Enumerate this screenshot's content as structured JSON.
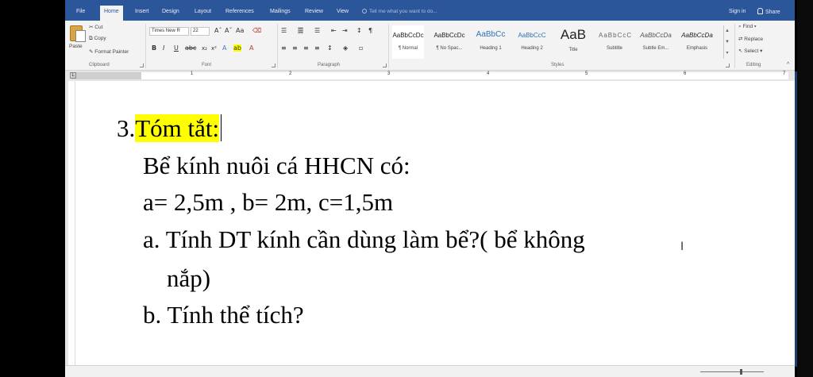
{
  "menu": {
    "tabs": [
      "File",
      "Home",
      "Insert",
      "Design",
      "Layout",
      "References",
      "Mailings",
      "Review",
      "View"
    ],
    "active_tab": "Home",
    "tell_me": "Tell me what you want to do...",
    "sign_in": "Sign in",
    "share": "Share"
  },
  "ribbon": {
    "clipboard": {
      "paste": "Paste",
      "cut": "Cut",
      "copy": "Copy",
      "format_painter": "Format Painter",
      "label": "Clipboard"
    },
    "font": {
      "family": "Times New R",
      "size": "22",
      "label": "Font"
    },
    "paragraph": {
      "label": "Paragraph"
    },
    "styles": {
      "label": "Styles",
      "items": [
        {
          "sample": "AaBbCcDc",
          "name": "¶ Normal"
        },
        {
          "sample": "AaBbCcDc",
          "name": "¶ No Spac..."
        },
        {
          "sample": "AaBbCc",
          "name": "Heading 1"
        },
        {
          "sample": "AaBbCcC",
          "name": "Heading 2"
        },
        {
          "sample": "AaB",
          "name": "Title"
        },
        {
          "sample": "AaBbCcC",
          "name": "Subtitle"
        },
        {
          "sample": "AaBbCcDa",
          "name": "Subtle Em..."
        },
        {
          "sample": "AaBbCcDa",
          "name": "Emphasis"
        }
      ]
    },
    "editing": {
      "find": "Find",
      "replace": "Replace",
      "select": "Select",
      "label": "Editing"
    }
  },
  "ruler": {
    "numbers": [
      "1",
      "2",
      "3",
      "4",
      "5",
      "6",
      "7"
    ]
  },
  "document": {
    "heading_number": "3.",
    "heading_text": "Tóm tắt:",
    "line1": "Bể kính nuôi cá HHCN có:",
    "line2": "a= 2,5m , b= 2m, c=1,5m",
    "item_a_marker": "a.",
    "item_a_text": "Tính DT kính cần dùng làm bể?( bể không",
    "item_a_cont": "nắp)",
    "item_b_marker": "b.",
    "item_b_text": "Tính thể tích?"
  },
  "colors": {
    "title_bar": "#2b579a",
    "highlight": "#ffff00"
  }
}
